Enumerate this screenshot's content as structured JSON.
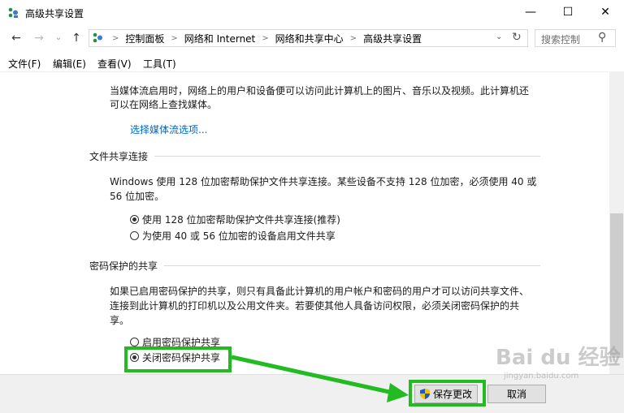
{
  "window": {
    "title": "高级共享设置",
    "min": "—",
    "max": "☐",
    "close": "✕"
  },
  "address": {
    "back": "←",
    "forward": "→",
    "recent": "⌄",
    "up": "↑",
    "crumbs": [
      "控制面板",
      "网络和 Internet",
      "网络和共享中心",
      "高级共享设置"
    ],
    "dropdown": "⌄",
    "refresh": "↻",
    "search_placeholder": "搜索控制",
    "search_icon": "⚲"
  },
  "menu": [
    "文件(F)",
    "编辑(E)",
    "查看(V)",
    "工具(T)"
  ],
  "content": {
    "media_text_1": "当媒体流启用时，网络上的用户和设备便可以访问此计算机上的图片、音乐以及视频。此计算机还",
    "media_text_2": "可以在网络上查找媒体。",
    "media_link": "选择媒体流选项...",
    "file_section": "文件共享连接",
    "file_text_1": "Windows 使用 128 位加密帮助保护文件共享连接。某些设备不支持 128 位加密，必须使用 40 或",
    "file_text_2": "56 位加密。",
    "file_opt1": "使用 128 位加密帮助保护文件共享连接(推荐)",
    "file_opt2": "为使用 40 或 56 位加密的设备启用文件共享",
    "pwd_section": "密码保护的共享",
    "pwd_text_1": "如果已启用密码保护的共享，则只有具备此计算机的用户帐户和密码的用户才可以访问共享文件、",
    "pwd_text_2": "连接到此计算机的打印机以及公用文件夹。若要使其他人具备访问权限，必须关闭密码保护的共",
    "pwd_text_3": "享。",
    "pwd_opt1": "启用密码保护共享",
    "pwd_opt2": "关闭密码保护共享"
  },
  "footer": {
    "save": "保存更改",
    "cancel": "取消"
  },
  "watermark": "Bai du 经验",
  "watermark_sub": "jingyan.baidu.com",
  "colors": {
    "highlight": "#22bb22",
    "link": "#0066cc"
  }
}
